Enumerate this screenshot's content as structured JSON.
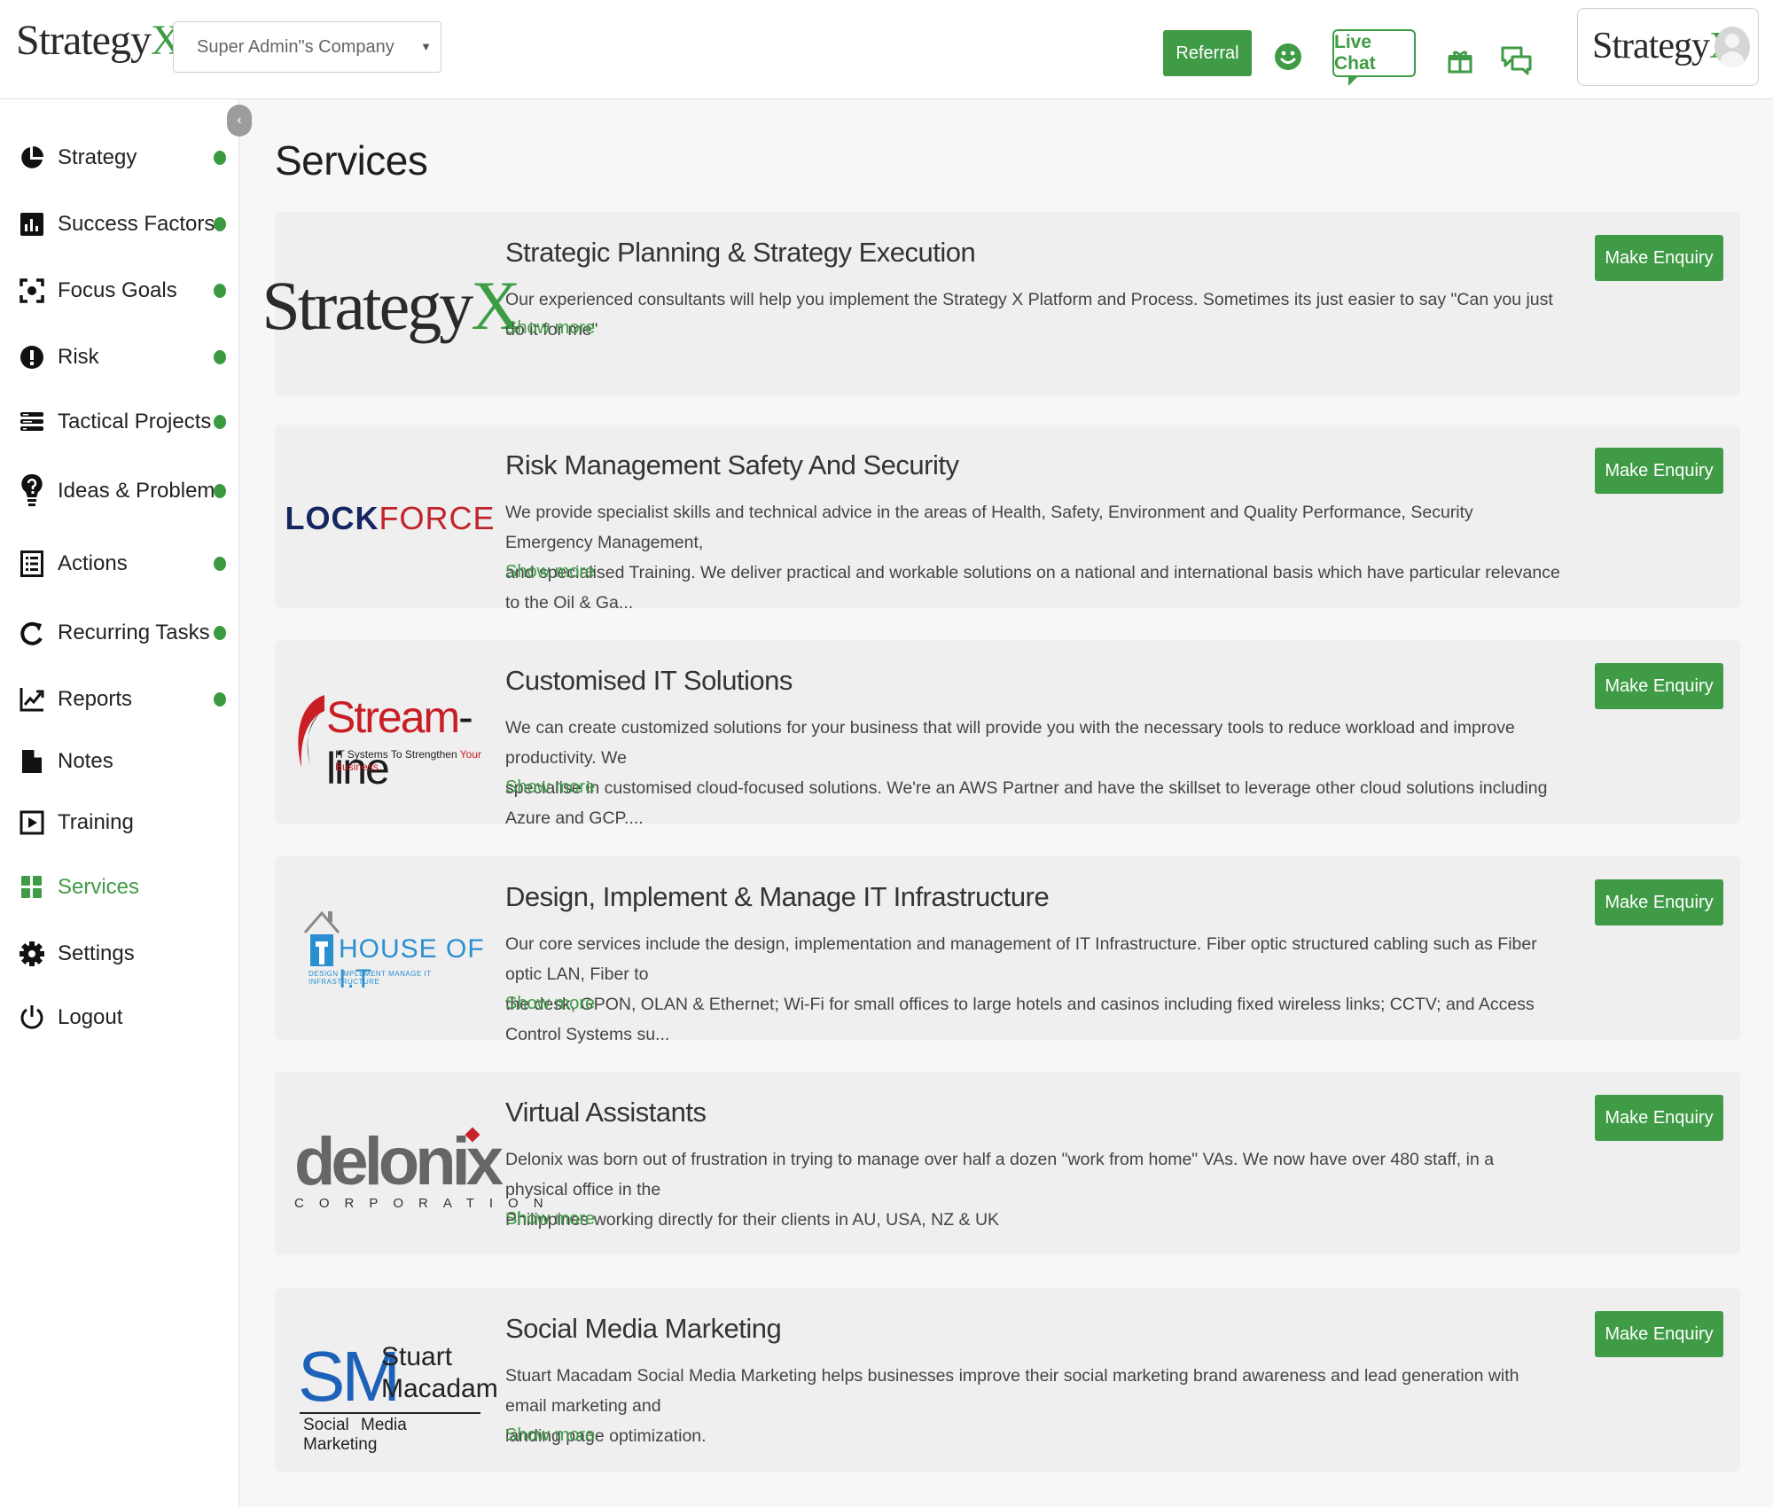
{
  "header": {
    "brand": {
      "text": "Strategy",
      "accent": "X"
    },
    "company_select": {
      "value": "Super Admin\"s Company"
    },
    "referral_label": "Referral",
    "live_chat_label": "Live Chat",
    "profile_brand": {
      "text": "Strategy",
      "accent": "X"
    }
  },
  "sidebar": {
    "items": [
      {
        "label": "Strategy",
        "icon": "pie-chart-icon",
        "dot": true
      },
      {
        "label": "Success Factors",
        "icon": "bar-chart-icon",
        "dot": true
      },
      {
        "label": "Focus Goals",
        "icon": "focus-target-icon",
        "dot": true
      },
      {
        "label": "Risk",
        "icon": "alert-circle-icon",
        "dot": true
      },
      {
        "label": "Tactical Projects",
        "icon": "tasks-list-icon",
        "dot": true
      },
      {
        "label": "Ideas & Problems",
        "icon": "lightbulb-question-icon",
        "dot": true
      },
      {
        "label": "Actions",
        "icon": "checklist-icon",
        "dot": true
      },
      {
        "label": "Recurring Tasks",
        "icon": "refresh-icon",
        "dot": true
      },
      {
        "label": "Reports",
        "icon": "line-chart-icon",
        "dot": true
      },
      {
        "label": "Notes",
        "icon": "note-icon",
        "dot": false
      },
      {
        "label": "Training",
        "icon": "play-icon",
        "dot": false
      },
      {
        "label": "Services",
        "icon": "grid-icon",
        "dot": false,
        "active": true
      },
      {
        "label": "Settings",
        "icon": "gear-icon",
        "dot": false
      },
      {
        "label": "Logout",
        "icon": "power-icon",
        "dot": false
      }
    ]
  },
  "main": {
    "title": "Services",
    "enquiry_label": "Make Enquiry",
    "show_more_label": "Show more",
    "services": [
      {
        "title": "Strategic Planning & Strategy Execution",
        "lines": [
          "Our experienced consultants will help you implement the Strategy X Platform and Process. Sometimes its just easier to say \"Can you just do it for me\""
        ],
        "logo": {
          "word": "Strategy",
          "accent": "X"
        }
      },
      {
        "title": "Risk Management Safety And Security",
        "lines": [
          "We provide specialist skills and technical advice in the areas of Health, Safety, Environment and Quality Performance, Security Emergency Management,",
          "and specialised Training. We deliver practical and workable solutions on a national and international basis which have particular relevance to the Oil & Ga..."
        ],
        "logo": {
          "a": "LOCK",
          "b": "F",
          "c": "O",
          "d": "RCE"
        }
      },
      {
        "title": "Customised IT Solutions",
        "lines": [
          "We can create customized solutions for your business that will provide you with the necessary tools to reduce workload and improve productivity. We",
          "specialise in customised cloud-focused solutions. We're an AWS Partner and have the skillset to leverage other cloud solutions including Azure and GCP...."
        ],
        "logo": {
          "a": "Stream",
          "b": "-line",
          "tag_a": "IT Systems To Strengthen ",
          "tag_b": "Your Business"
        }
      },
      {
        "title": "Design, Implement & Manage IT Infrastructure",
        "lines": [
          "Our core services include the design, implementation and management of IT Infrastructure. Fiber optic structured cabling such as Fiber optic LAN, Fiber to",
          "the desk, GPON, OLAN & Ethernet; Wi-Fi for small offices to large hotels and casinos including fixed wireless links; CCTV; and Access Control Systems su..."
        ],
        "logo": {
          "word": "HOUSE OF I.T",
          "sub": "DESIGN IMPLEMENT MANAGE IT INFRASTRUCTURE"
        }
      },
      {
        "title": "Virtual Assistants",
        "lines": [
          "Delonix was born out of frustration in trying to manage over half a dozen \"work from home\" VAs. We now have over 480 staff, in a physical office in the",
          "Philippines working directly for their clients in AU, USA, NZ & UK"
        ],
        "logo": {
          "word": "delonix",
          "sub": "CORPORATION"
        }
      },
      {
        "title": "Social Media Marketing",
        "lines": [
          "Stuart Macadam Social Media Marketing helps businesses improve their social marketing brand awareness and lead generation with email marketing and",
          "landing page optimization."
        ],
        "logo": {
          "big": "SM",
          "first": "Stuart",
          "last": "Macadam",
          "foot": "Social Media Marketing"
        }
      }
    ]
  },
  "colors": {
    "accent": "#3f9b45",
    "card_bg": "#efefef",
    "sidebar_dot": "#3a9a40"
  }
}
